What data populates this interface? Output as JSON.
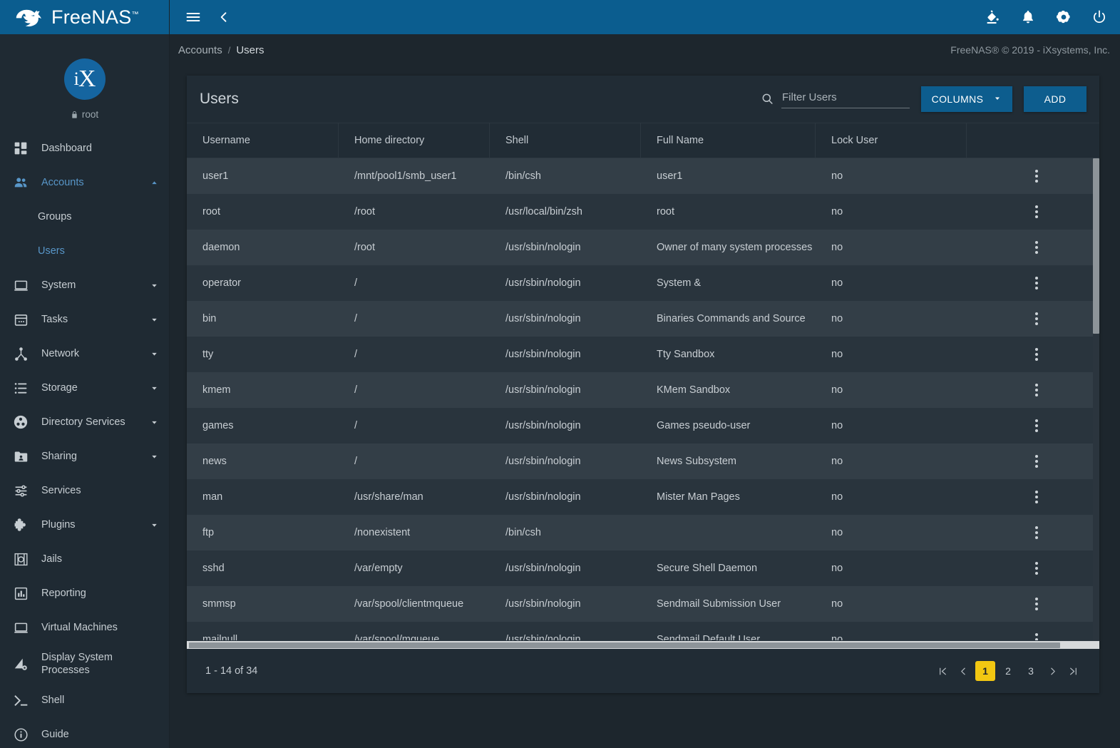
{
  "brand": {
    "name": "FreeNAS",
    "tm": "™"
  },
  "sidebar": {
    "avatar_initials": "iX",
    "user": "root",
    "lock_icon": "lock-icon",
    "items": [
      {
        "label": "Dashboard",
        "icon": "dashboard-icon",
        "active": false,
        "expandable": false
      },
      {
        "label": "Accounts",
        "icon": "accounts-icon",
        "active": true,
        "expandable": true,
        "expanded": true
      },
      {
        "label": "System",
        "icon": "system-icon",
        "active": false,
        "expandable": true
      },
      {
        "label": "Tasks",
        "icon": "tasks-icon",
        "active": false,
        "expandable": true
      },
      {
        "label": "Network",
        "icon": "network-icon",
        "active": false,
        "expandable": true
      },
      {
        "label": "Storage",
        "icon": "storage-icon",
        "active": false,
        "expandable": true
      },
      {
        "label": "Directory Services",
        "icon": "directory-services-icon",
        "active": false,
        "expandable": true
      },
      {
        "label": "Sharing",
        "icon": "sharing-icon",
        "active": false,
        "expandable": true
      },
      {
        "label": "Services",
        "icon": "services-icon",
        "active": false,
        "expandable": false
      },
      {
        "label": "Plugins",
        "icon": "plugins-icon",
        "active": false,
        "expandable": true
      },
      {
        "label": "Jails",
        "icon": "jails-icon",
        "active": false,
        "expandable": false
      },
      {
        "label": "Reporting",
        "icon": "reporting-icon",
        "active": false,
        "expandable": false
      },
      {
        "label": "Virtual Machines",
        "icon": "virtual-machines-icon",
        "active": false,
        "expandable": false
      },
      {
        "label": "Display System\nProcesses",
        "icon": "display-system-processes-icon",
        "active": false,
        "expandable": false
      },
      {
        "label": "Shell",
        "icon": "shell-icon",
        "active": false,
        "expandable": false
      },
      {
        "label": "Guide",
        "icon": "guide-icon",
        "active": false,
        "expandable": false
      }
    ],
    "subitems": [
      {
        "label": "Groups",
        "active": false
      },
      {
        "label": "Users",
        "active": true
      }
    ]
  },
  "topbar": {
    "menu_icon": "hamburger-menu-icon",
    "collapse_icon": "chevron-left-icon",
    "actions": [
      {
        "name": "theme-icon"
      },
      {
        "name": "notifications-bell-icon"
      },
      {
        "name": "settings-gear-icon"
      },
      {
        "name": "power-icon"
      }
    ]
  },
  "breadcrumb": {
    "parent": "Accounts",
    "separator": "/",
    "current": "Users"
  },
  "copyright": "FreeNAS® © 2019 - iXsystems, Inc.",
  "card": {
    "title": "Users",
    "search": {
      "placeholder": "Filter Users",
      "value": ""
    },
    "columns_button": "COLUMNS",
    "add_button": "ADD",
    "table": {
      "headers": [
        "Username",
        "Home directory",
        "Shell",
        "Full Name",
        "Lock User",
        ""
      ],
      "rows": [
        {
          "username": "user1",
          "home": "/mnt/pool1/smb_user1",
          "shell": "/bin/csh",
          "fullname": "user1",
          "lock": "no"
        },
        {
          "username": "root",
          "home": "/root",
          "shell": "/usr/local/bin/zsh",
          "fullname": "root",
          "lock": "no"
        },
        {
          "username": "daemon",
          "home": "/root",
          "shell": "/usr/sbin/nologin",
          "fullname": "Owner of many system processes",
          "lock": "no"
        },
        {
          "username": "operator",
          "home": "/",
          "shell": "/usr/sbin/nologin",
          "fullname": "System &",
          "lock": "no"
        },
        {
          "username": "bin",
          "home": "/",
          "shell": "/usr/sbin/nologin",
          "fullname": "Binaries Commands and Source",
          "lock": "no"
        },
        {
          "username": "tty",
          "home": "/",
          "shell": "/usr/sbin/nologin",
          "fullname": "Tty Sandbox",
          "lock": "no"
        },
        {
          "username": "kmem",
          "home": "/",
          "shell": "/usr/sbin/nologin",
          "fullname": "KMem Sandbox",
          "lock": "no"
        },
        {
          "username": "games",
          "home": "/",
          "shell": "/usr/sbin/nologin",
          "fullname": "Games pseudo-user",
          "lock": "no"
        },
        {
          "username": "news",
          "home": "/",
          "shell": "/usr/sbin/nologin",
          "fullname": "News Subsystem",
          "lock": "no"
        },
        {
          "username": "man",
          "home": "/usr/share/man",
          "shell": "/usr/sbin/nologin",
          "fullname": "Mister Man Pages",
          "lock": "no"
        },
        {
          "username": "ftp",
          "home": "/nonexistent",
          "shell": "/bin/csh",
          "fullname": "",
          "lock": "no"
        },
        {
          "username": "sshd",
          "home": "/var/empty",
          "shell": "/usr/sbin/nologin",
          "fullname": "Secure Shell Daemon",
          "lock": "no"
        },
        {
          "username": "smmsp",
          "home": "/var/spool/clientmqueue",
          "shell": "/usr/sbin/nologin",
          "fullname": "Sendmail Submission User",
          "lock": "no"
        },
        {
          "username": "mailnull",
          "home": "/var/spool/mqueue",
          "shell": "/usr/sbin/nologin",
          "fullname": "Sendmail Default User",
          "lock": "no"
        }
      ]
    },
    "footer": {
      "range": "1 - 14 of 34",
      "pages": [
        "1",
        "2",
        "3"
      ],
      "current_page": "1",
      "first_icon": "first-page-icon",
      "prev_icon": "previous-page-icon",
      "next_icon": "next-page-icon",
      "last_icon": "last-page-icon"
    }
  },
  "colors": {
    "brand_blue": "#0b5d8f",
    "accent_blue": "#5896c8",
    "page_active_yellow": "#f2c712",
    "sidebar_bg": "#1f2a33",
    "card_bg": "#212c35",
    "row_odd": "#333e47",
    "row_even": "#29343d"
  }
}
